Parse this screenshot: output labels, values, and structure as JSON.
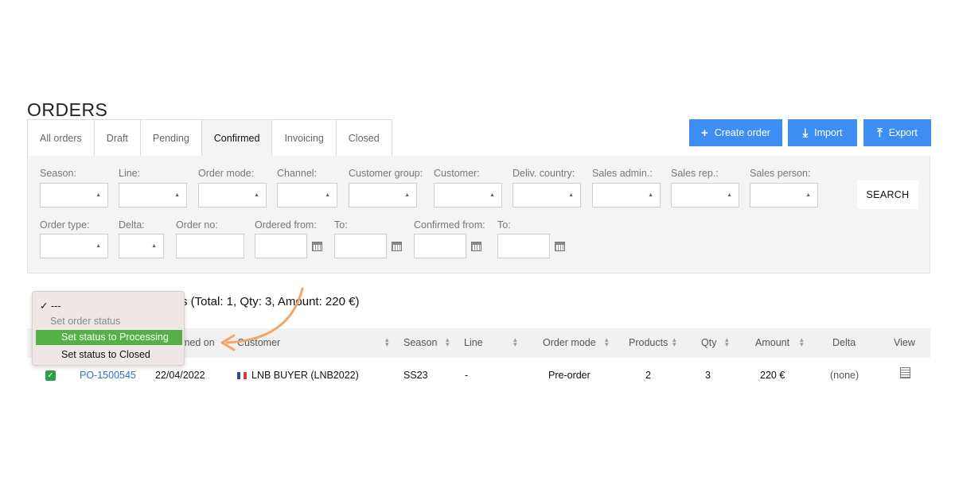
{
  "page": {
    "title": "ORDERS"
  },
  "tabs": [
    "All orders",
    "Draft",
    "Pending",
    "Confirmed",
    "Invoicing",
    "Closed"
  ],
  "active_tab": "Confirmed",
  "actions": {
    "create": "Create order",
    "import": "Import",
    "export": "Export"
  },
  "filters": {
    "season": "Season:",
    "line": "Line:",
    "order_mode": "Order mode:",
    "channel": "Channel:",
    "customer_group": "Customer group:",
    "customer": "Customer:",
    "deliv_country": "Deliv. country:",
    "sales_admin": "Sales admin.:",
    "sales_rep": "Sales rep.:",
    "sales_person": "Sales person:",
    "order_type": "Order type:",
    "delta": "Delta:",
    "order_no": "Order no:",
    "ordered_from": "Ordered from:",
    "ordered_to": "To:",
    "confirmed_from": "Confirmed from:",
    "confirmed_to": "To:",
    "search": "SEARCH"
  },
  "summary": "s (Total: 1, Qty: 3, Amount: 220 €)",
  "columns": {
    "confirmed_on": "med on",
    "customer": "Customer",
    "season": "Season",
    "line": "Line",
    "order_mode": "Order mode",
    "products": "Products",
    "qty": "Qty",
    "amount": "Amount",
    "delta": "Delta",
    "view": "View"
  },
  "rows": [
    {
      "order_no": "PO-1500545",
      "confirmed_on": "22/04/2022",
      "customer": "LNB BUYER (LNB2022)",
      "season": "SS23",
      "line": "-",
      "order_mode": "Pre-order",
      "products": "2",
      "qty": "3",
      "amount": "220 €",
      "delta": "(none)"
    }
  ],
  "bulk_menu": {
    "selected": "✓ ---",
    "group_label": "Set order status",
    "options": [
      "Set status to Processing",
      "Set status to Closed"
    ]
  },
  "colors": {
    "primary": "#3d8ef2",
    "highlight": "#55b048",
    "arrow": "#f4a36b",
    "link": "#2f6fd1"
  }
}
